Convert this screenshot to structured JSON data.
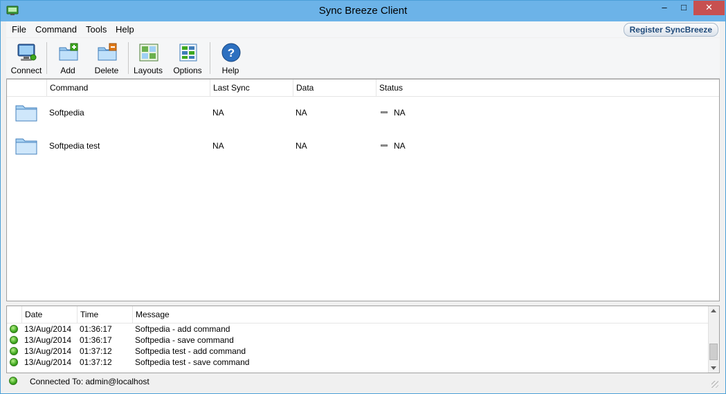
{
  "window": {
    "title": "Sync Breeze Client",
    "minimize": "‒",
    "maximize": "□",
    "close": "✕"
  },
  "menu": {
    "items": [
      "File",
      "Command",
      "Tools",
      "Help"
    ],
    "register": "Register SyncBreeze"
  },
  "toolbar": {
    "connect": "Connect",
    "add": "Add",
    "delete": "Delete",
    "layouts": "Layouts",
    "options": "Options",
    "help": "Help"
  },
  "commands": {
    "headers": {
      "command": "Command",
      "last_sync": "Last Sync",
      "data": "Data",
      "status": "Status"
    },
    "rows": [
      {
        "command": "Softpedia",
        "last_sync": "NA",
        "data": "NA",
        "status": "NA"
      },
      {
        "command": "Softpedia test",
        "last_sync": "NA",
        "data": "NA",
        "status": "NA"
      }
    ]
  },
  "log": {
    "headers": {
      "date": "Date",
      "time": "Time",
      "message": "Message"
    },
    "rows": [
      {
        "date": "13/Aug/2014",
        "time": "01:36:17",
        "message": "Softpedia - add command"
      },
      {
        "date": "13/Aug/2014",
        "time": "01:36:17",
        "message": "Softpedia - save command"
      },
      {
        "date": "13/Aug/2014",
        "time": "01:37:12",
        "message": "Softpedia test - add command"
      },
      {
        "date": "13/Aug/2014",
        "time": "01:37:12",
        "message": "Softpedia test - save command"
      }
    ]
  },
  "statusbar": {
    "text": "Connected To: admin@localhost"
  },
  "colors": {
    "titlebar": "#6cb3e8",
    "close": "#c75050",
    "ok_green": "#3ea81e"
  }
}
